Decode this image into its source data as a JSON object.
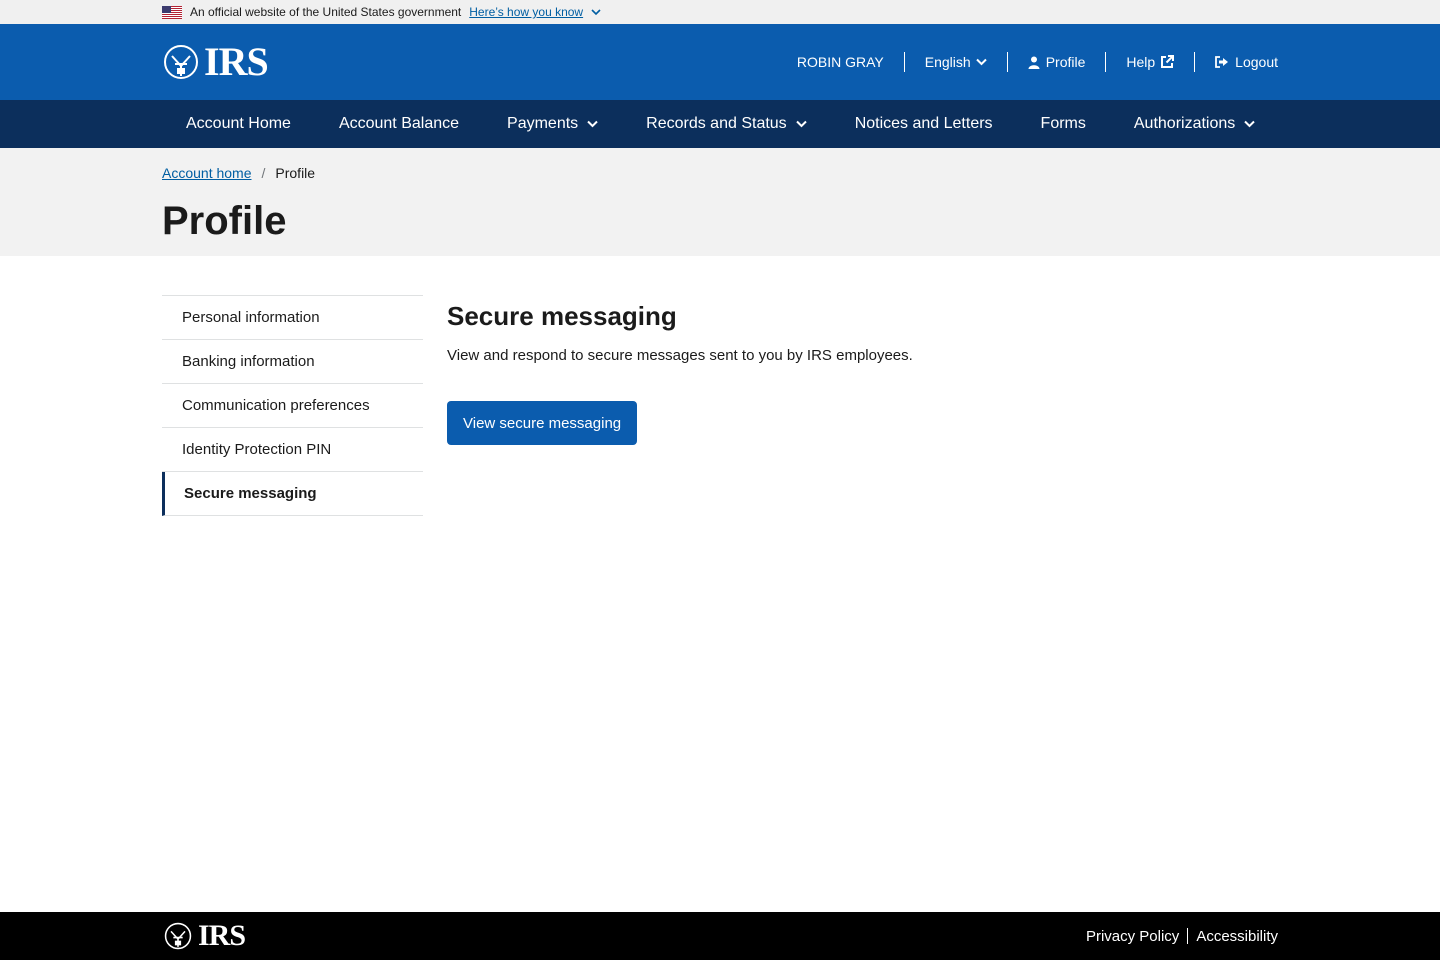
{
  "gov_banner": {
    "text": "An official website of the United States government",
    "link": "Here’s how you know",
    "flag_icon": "us-flag-icon",
    "chevron_icon": "chevron-down-icon"
  },
  "header": {
    "logo_text": "IRS",
    "user_name": "ROBIN GRAY",
    "language": "English",
    "profile": "Profile",
    "help": "Help",
    "logout": "Logout",
    "brand_color": "#0b5cae"
  },
  "nav": {
    "items": [
      {
        "label": "Account Home"
      },
      {
        "label": "Account Balance"
      },
      {
        "label": "Payments"
      },
      {
        "label": "Records and Status"
      },
      {
        "label": "Notices and Letters"
      },
      {
        "label": "Forms"
      },
      {
        "label": "Authorizations"
      }
    ],
    "bg_color": "#0c2f5c"
  },
  "breadcrumb": {
    "home": "Account home",
    "separator": "/",
    "current": "Profile"
  },
  "page_title": "Profile",
  "sidenav": {
    "items": [
      {
        "label": "Personal information"
      },
      {
        "label": "Banking information"
      },
      {
        "label": "Communication preferences"
      },
      {
        "label": "Identity Protection PIN"
      },
      {
        "label": "Secure messaging",
        "active": true
      }
    ]
  },
  "content": {
    "heading": "Secure messaging",
    "description": "View and respond to secure messages sent to you by IRS employees.",
    "button": "View secure messaging"
  },
  "footer": {
    "logo_text": "IRS",
    "privacy": "Privacy Policy",
    "accessibility": "Accessibility"
  }
}
